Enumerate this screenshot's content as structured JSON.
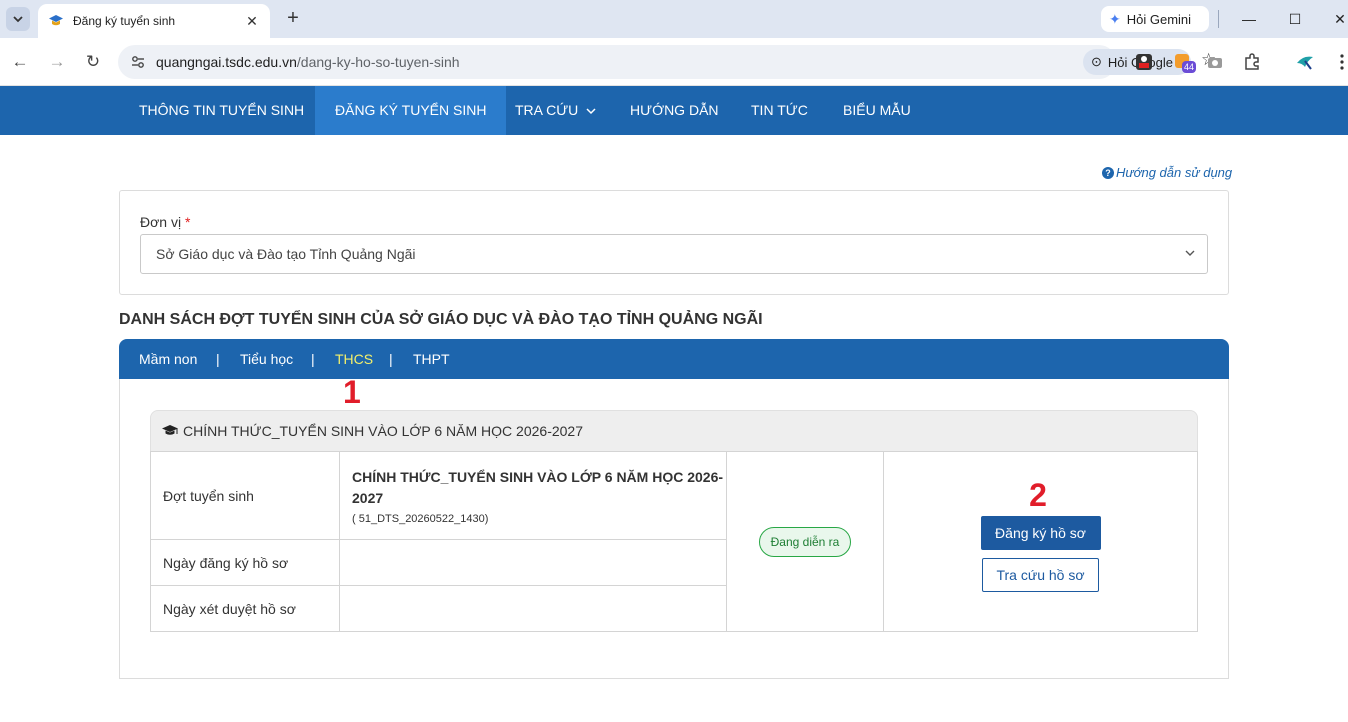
{
  "browser": {
    "tab_title": "Đăng ký tuyển sinh",
    "tab_close": "✕",
    "new_tab": "+",
    "gemini_label": "Hỏi Gemini",
    "url_host": "quangngai.tsdc.edu.vn",
    "url_path": "/dang-ky-ho-so-tuyen-sinh",
    "ask_google_label": "Hỏi Google",
    "extension_badge": "44",
    "back_icon": "←",
    "forward_icon": "→",
    "reload_icon": "↻",
    "bookmark_icon": "☆",
    "minimize_icon": "—",
    "maximize_icon": "☐",
    "close_icon": "✕"
  },
  "nav": {
    "items": [
      {
        "label": "THÔNG TIN TUYỂN SINH"
      },
      {
        "label": "ĐĂNG KÝ TUYỂN SINH"
      },
      {
        "label": "TRA CỨU"
      },
      {
        "label": "HƯỚNG DẪN"
      },
      {
        "label": "TIN TỨC"
      },
      {
        "label": "BIỂU MẪU"
      }
    ],
    "active_index": 1
  },
  "help_link": "Hướng dẫn sử dụng",
  "unit": {
    "label": "Đơn vị",
    "required_mark": "*",
    "selected": "Sở Giáo dục và Đào tạo Tỉnh Quảng Ngãi"
  },
  "list_title": "DANH SÁCH ĐỢT TUYỂN SINH CỦA SỞ GIÁO DỤC VÀ ĐÀO TẠO TỈNH QUẢNG NGÃI",
  "levels": {
    "items": [
      "Mầm non",
      "Tiểu học",
      "THCS",
      "THPT"
    ],
    "separator": "|",
    "active_index": 2
  },
  "annotations": {
    "one": "1",
    "two": "2"
  },
  "round": {
    "header": "CHÍNH THỨC_TUYỂN SINH VÀO LỚP 6 NĂM HỌC 2026-2027",
    "row_labels": [
      "Đợt tuyển sinh",
      "Ngày đăng ký hồ sơ",
      "Ngày xét duyệt hồ sơ"
    ],
    "name": "CHÍNH THỨC_TUYỂN SINH VÀO LỚP 6 NĂM HỌC 2026-2027",
    "code": "( 51_DTS_20260522_1430)",
    "register_date": "",
    "review_date": "",
    "status": "Đang diễn ra",
    "register_button": "Đăng ký hồ sơ",
    "lookup_button": "Tra cứu hồ sơ"
  },
  "colors": {
    "primary": "#1d65ad",
    "active_level": "#f4f06a",
    "annotation": "#e11d2a",
    "status_green": "#28a745"
  }
}
